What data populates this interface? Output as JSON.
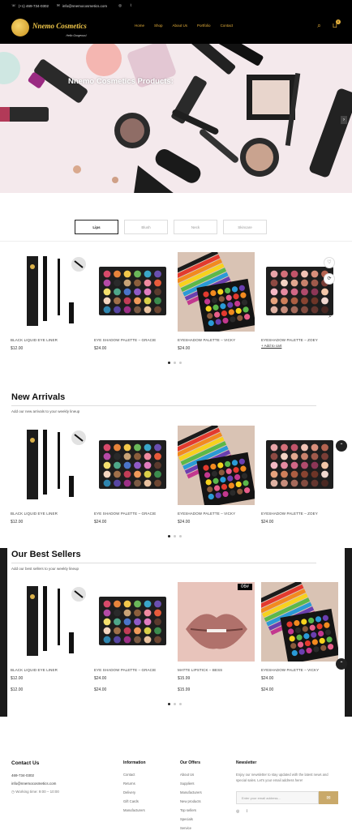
{
  "topbar": {
    "phone": "(+1) 469-734-0302",
    "email": "info@nnemocosmetics.com"
  },
  "brand": {
    "name": "Nnemo Cosmetics",
    "tagline": "Hello Gorgeous!"
  },
  "nav": {
    "items": [
      "Home",
      "Shop",
      "About Us",
      "Portfolio",
      "Contact"
    ]
  },
  "header": {
    "cart_count": "0"
  },
  "hero": {
    "title": "Nnemo Cosmetics Products:"
  },
  "category_tabs": [
    "Lips",
    "Blush",
    "Neck",
    "Skincare"
  ],
  "featured": {
    "products": [
      {
        "name": "BLACK LIQUID EYE LINER",
        "price": "$12.00"
      },
      {
        "name": "EYE SHADOW PALETTE – GRACIE",
        "price": "$24.00"
      },
      {
        "name": "EYESHADOW PALETTE – VICKY",
        "price": "$24.00"
      },
      {
        "name": "EYESHADOW PALETTE – ZOEY",
        "add_to_cart": "+ Add to cart"
      }
    ]
  },
  "new_arrivals": {
    "title": "New Arrivals",
    "subtitle": "Add our new arrivals to your weekly lineup",
    "products": [
      {
        "name": "BLACK LIQUID EYE LINER",
        "price": "$12.00"
      },
      {
        "name": "EYE SHADOW PALETTE – GRACIE",
        "price": "$24.00"
      },
      {
        "name": "EYESHADOW PALETTE – VICKY",
        "price": "$24.00"
      },
      {
        "name": "EYESHADOW PALETTE – ZOEY",
        "price": "$24.00"
      }
    ]
  },
  "best_sellers": {
    "title": "Our Best Sellers",
    "subtitle": "Add our best sellers to your weekly lineup",
    "badge": "06#",
    "products": [
      {
        "name": "BLACK LIQUID EYE LINER",
        "price": "$12.00",
        "price2": "$12.00"
      },
      {
        "name": "EYE SHADOW PALETTE – GRACIE",
        "price": "$24.00",
        "price2": "$24.00"
      },
      {
        "name": "MATTE LIPSTICK – BESS",
        "price": "$15.99",
        "price2": "$15.99"
      },
      {
        "name": "EYESHADOW PALETTE – VICKY",
        "price": "$24.00",
        "price2": "$24.00"
      }
    ]
  },
  "footer": {
    "contact": {
      "heading": "Contact Us",
      "phone": "469-734-0302",
      "email": "info@nnemocosmetics.com",
      "hours": "Working time: 9:00 – 10:00"
    },
    "information": {
      "heading": "Information",
      "links": [
        "Contact",
        "Returns",
        "Delivery",
        "Gift Cards",
        "Manufacturers"
      ]
    },
    "offers": {
      "heading": "Our Offers",
      "links": [
        "About Us",
        "Suppliers",
        "Manufacturers",
        "New products",
        "Top sellers",
        "Specials",
        "Service"
      ]
    },
    "newsletter": {
      "heading": "Newsletter",
      "text": "Enjoy our newsletter to stay updated with the latest news and special sales. Let's your email address here!",
      "placeholder": "Enter your email address..."
    }
  },
  "colors": {
    "accent": "#e8b23c",
    "dark": "#000000",
    "button": "#c9a96a"
  }
}
